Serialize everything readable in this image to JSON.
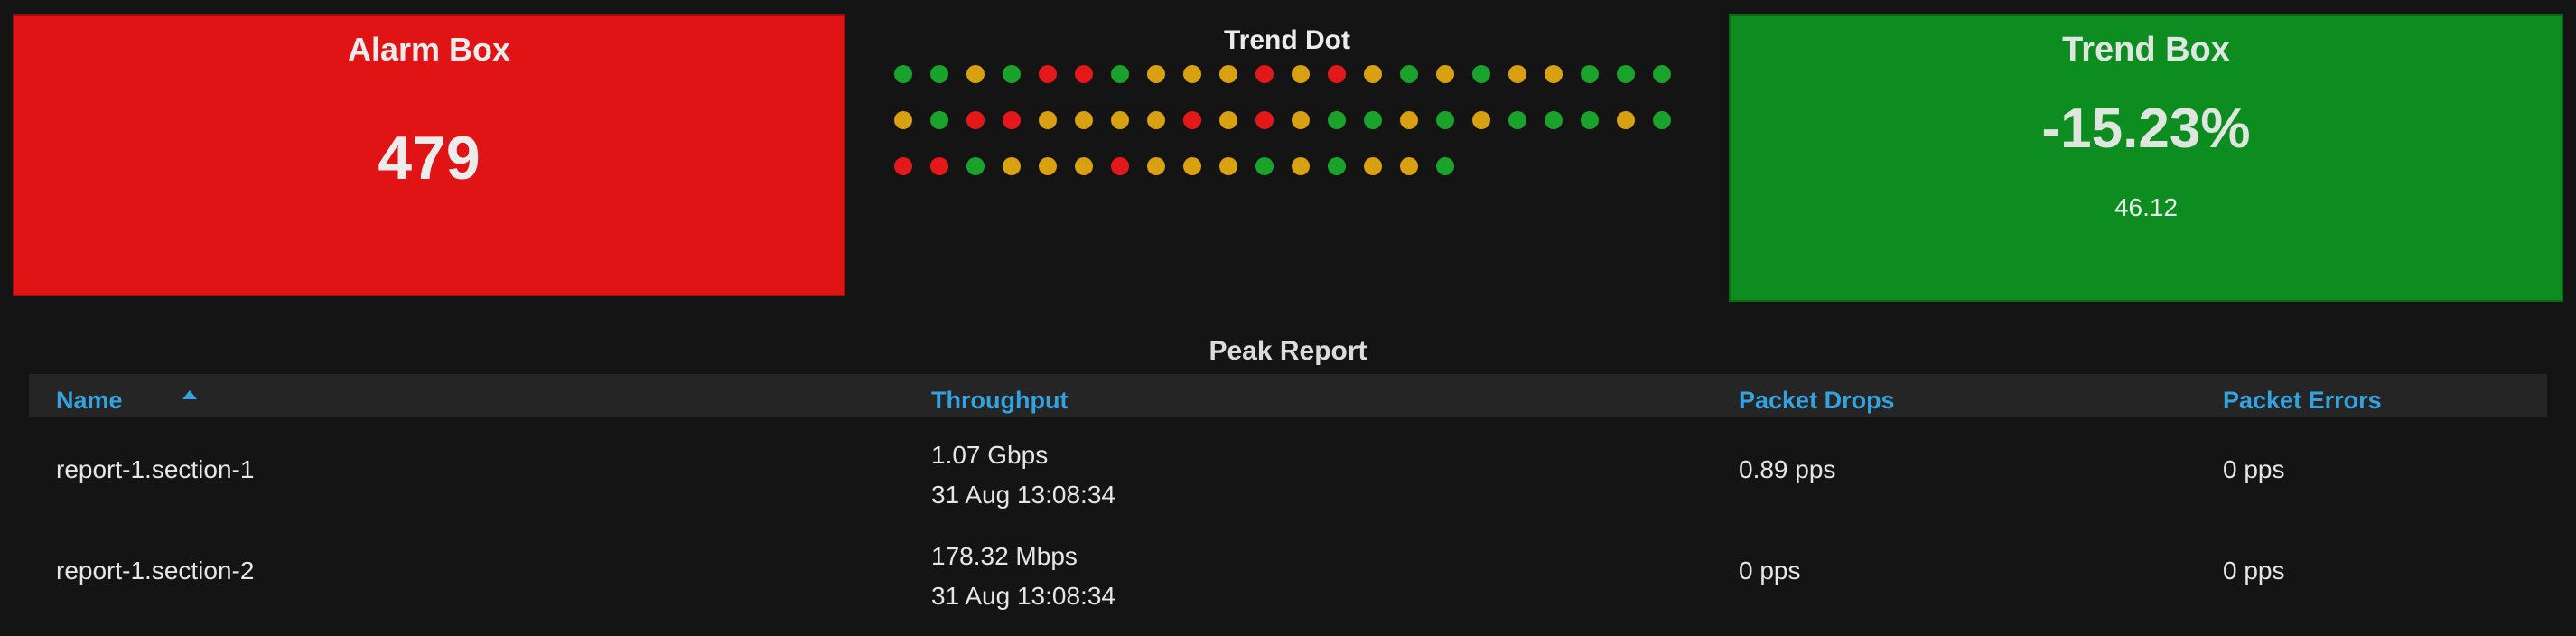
{
  "alarm_box": {
    "title": "Alarm Box",
    "value": "479",
    "color": "#e01414"
  },
  "trend_dot": {
    "title": "Trend Dot",
    "colors": {
      "green": "#1aa32a",
      "amber": "#d9a011",
      "red": "#e31818"
    },
    "rows": [
      [
        "green",
        "green",
        "amber",
        "green",
        "red",
        "red",
        "green",
        "amber",
        "amber",
        "amber",
        "red",
        "amber",
        "red",
        "amber",
        "green",
        "amber",
        "green",
        "amber",
        "amber",
        "green",
        "green",
        "green"
      ],
      [
        "amber",
        "green",
        "red",
        "red",
        "amber",
        "amber",
        "amber",
        "amber",
        "red",
        "amber",
        "red",
        "amber",
        "green",
        "green",
        "amber",
        "green",
        "amber",
        "green",
        "green",
        "green",
        "amber",
        "green"
      ],
      [
        "red",
        "red",
        "green",
        "amber",
        "amber",
        "amber",
        "red",
        "amber",
        "amber",
        "amber",
        "green",
        "amber",
        "green",
        "amber",
        "amber",
        "green"
      ]
    ]
  },
  "trend_box": {
    "title": "Trend Box",
    "value": "-15.23%",
    "sub": "46.12",
    "color": "#0d8c20"
  },
  "report": {
    "title": "Peak Report",
    "columns": [
      "Name",
      "Throughput",
      "Packet Drops",
      "Packet Errors"
    ],
    "sorted_column": "Name",
    "sort_direction": "ascending",
    "rows": [
      {
        "name": "report-1.section-1",
        "throughput": "1.07 Gbps",
        "time": "31 Aug 13:08:34",
        "drops": "0.89 pps",
        "errors": "0 pps"
      },
      {
        "name": "report-1.section-2",
        "throughput": "178.32 Mbps",
        "time": "31 Aug 13:08:34",
        "drops": "0 pps",
        "errors": "0 pps"
      }
    ]
  }
}
